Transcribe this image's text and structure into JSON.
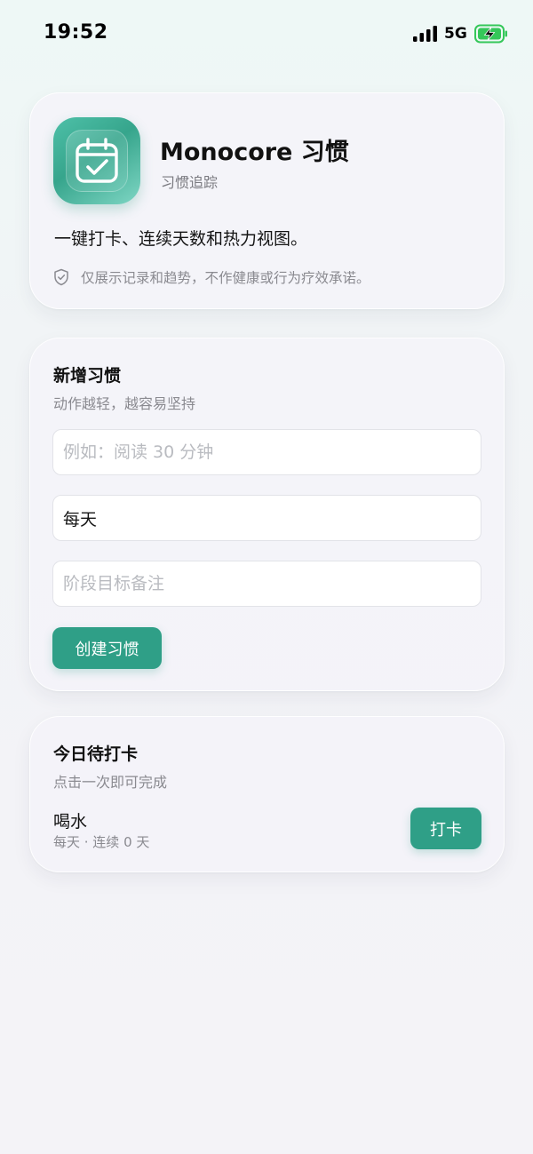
{
  "status_bar": {
    "time": "19:52",
    "network": "5G",
    "icons": [
      "signal-icon",
      "battery-charging-icon"
    ]
  },
  "app_card": {
    "logo_icon": "calendar-check-icon",
    "title": "Monocore 习惯",
    "subtitle": "习惯追踪",
    "description": "一键打卡、连续天数和热力视图。",
    "note_icon": "shield-check-icon",
    "note": "仅展示记录和趋势，不作健康或行为疗效承诺。"
  },
  "new_habit": {
    "title": "新增习惯",
    "subtitle": "动作越轻，越容易坚持",
    "name_placeholder": "例如：阅读 30 分钟",
    "frequency_value": "每天",
    "goal_placeholder": "阶段目标备注",
    "create_label": "创建习惯"
  },
  "today": {
    "title": "今日待打卡",
    "subtitle": "点击一次即可完成",
    "habits": [
      {
        "name": "喝水",
        "meta": "每天 · 连续 0 天",
        "action_label": "打卡"
      }
    ]
  },
  "colors": {
    "accent": "#2f9f87",
    "logo_gradient_start": "#4ec0a8",
    "logo_gradient_end": "#7fd6c4"
  }
}
